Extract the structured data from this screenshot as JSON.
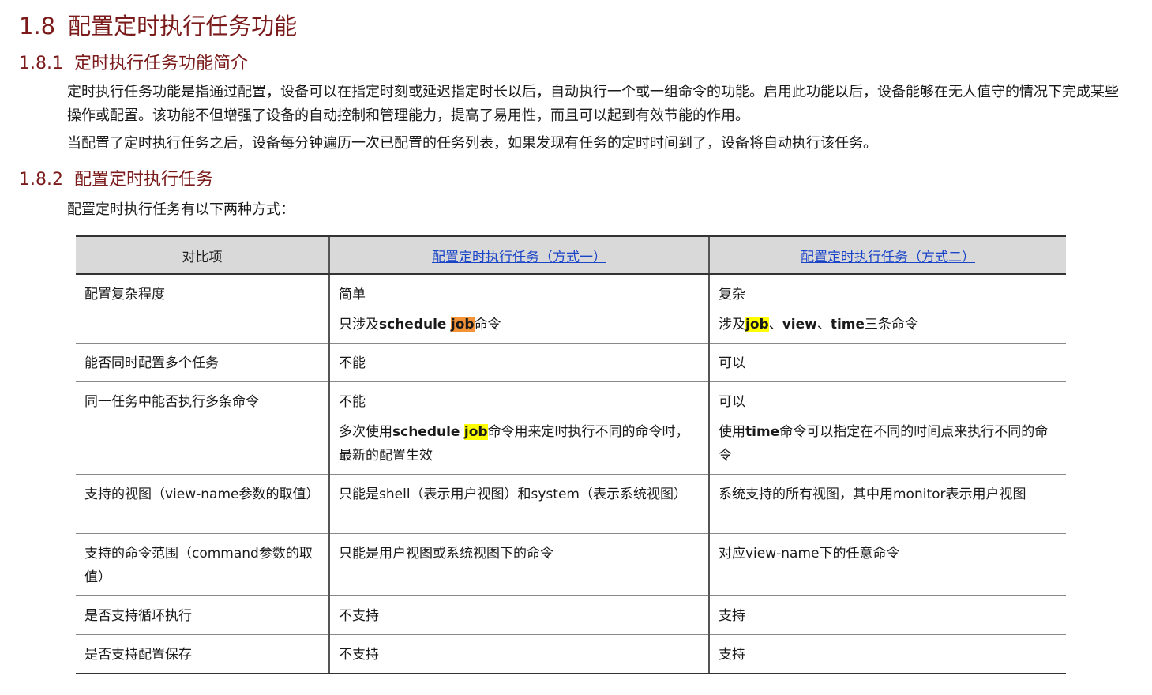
{
  "heading_1_8": {
    "number": "1.8",
    "title": "配置定时执行任务功能"
  },
  "heading_1_8_1": {
    "number": "1.8.1",
    "title": "定时执行任务功能简介"
  },
  "intro": {
    "para1": "定时执行任务功能是指通过配置，设备可以在指定时刻或延迟指定时长以后，自动执行一个或一组命令的功能。启用此功能以后，设备能够在无人值守的情况下完成某些操作或配置。该功能不但增强了设备的自动控制和管理能力，提高了易用性，而且可以起到有效节能的作用。",
    "para2": "当配置了定时执行任务之后，设备每分钟遍历一次已配置的任务列表，如果发现有任务的定时时间到了，设备将自动执行该任务。"
  },
  "heading_1_8_2": {
    "number": "1.8.2",
    "title": "配置定时执行任务"
  },
  "config_intro": "配置定时执行任务有以下两种方式：",
  "table": {
    "headers": {
      "item": "对比项",
      "mode1": "配置定时执行任务（方式一）",
      "mode2": "配置定时执行任务（方式二）"
    },
    "rows": {
      "r1": {
        "item": "配置复杂程度",
        "m1_line1": "简单",
        "m1_pre": "只涉及",
        "m1_kw1": "schedule",
        "m1_kw2": "job",
        "m1_post": "命令",
        "m2_line1": "复杂",
        "m2_pre": "涉及",
        "m2_kw1": "job",
        "m2_sep1": "、",
        "m2_kw2": "view",
        "m2_sep2": "、",
        "m2_kw3": "time",
        "m2_post": "三条命令"
      },
      "r2": {
        "item": "能否同时配置多个任务",
        "m1": "不能",
        "m2": "可以"
      },
      "r3": {
        "item": "同一任务中能否执行多条命令",
        "m1_line1": "不能",
        "m1_pre": "多次使用",
        "m1_kw1": "schedule",
        "m1_kw2": "job",
        "m1_post": "命令用来定时执行不同的命令时，最新的配置生效",
        "m2_line1": "可以",
        "m2_pre": "使用",
        "m2_kw1": "time",
        "m2_post": "命令可以指定在不同的时间点来执行不同的命令"
      },
      "r4": {
        "item": "支持的视图（view-name参数的取值）",
        "m1": "只能是shell（表示用户视图）和system（表示系统视图）",
        "m2": "系统支持的所有视图，其中用monitor表示用户视图"
      },
      "r5": {
        "item": "支持的命令范围（command参数的取值）",
        "m1": "只能是用户视图或系统视图下的命令",
        "m2": "对应view-name下的任意命令"
      },
      "r6": {
        "item": "是否支持循环执行",
        "m1": "不支持",
        "m2": "支持"
      },
      "r7": {
        "item": "是否支持配置保存",
        "m1": "不支持",
        "m2": "支持"
      }
    }
  },
  "colors": {
    "heading": "#7a1a1a",
    "link": "#1a44c8",
    "header_bg": "#d9d9d9",
    "highlight_orange": "#f39237",
    "highlight_yellow": "#ffff00"
  }
}
